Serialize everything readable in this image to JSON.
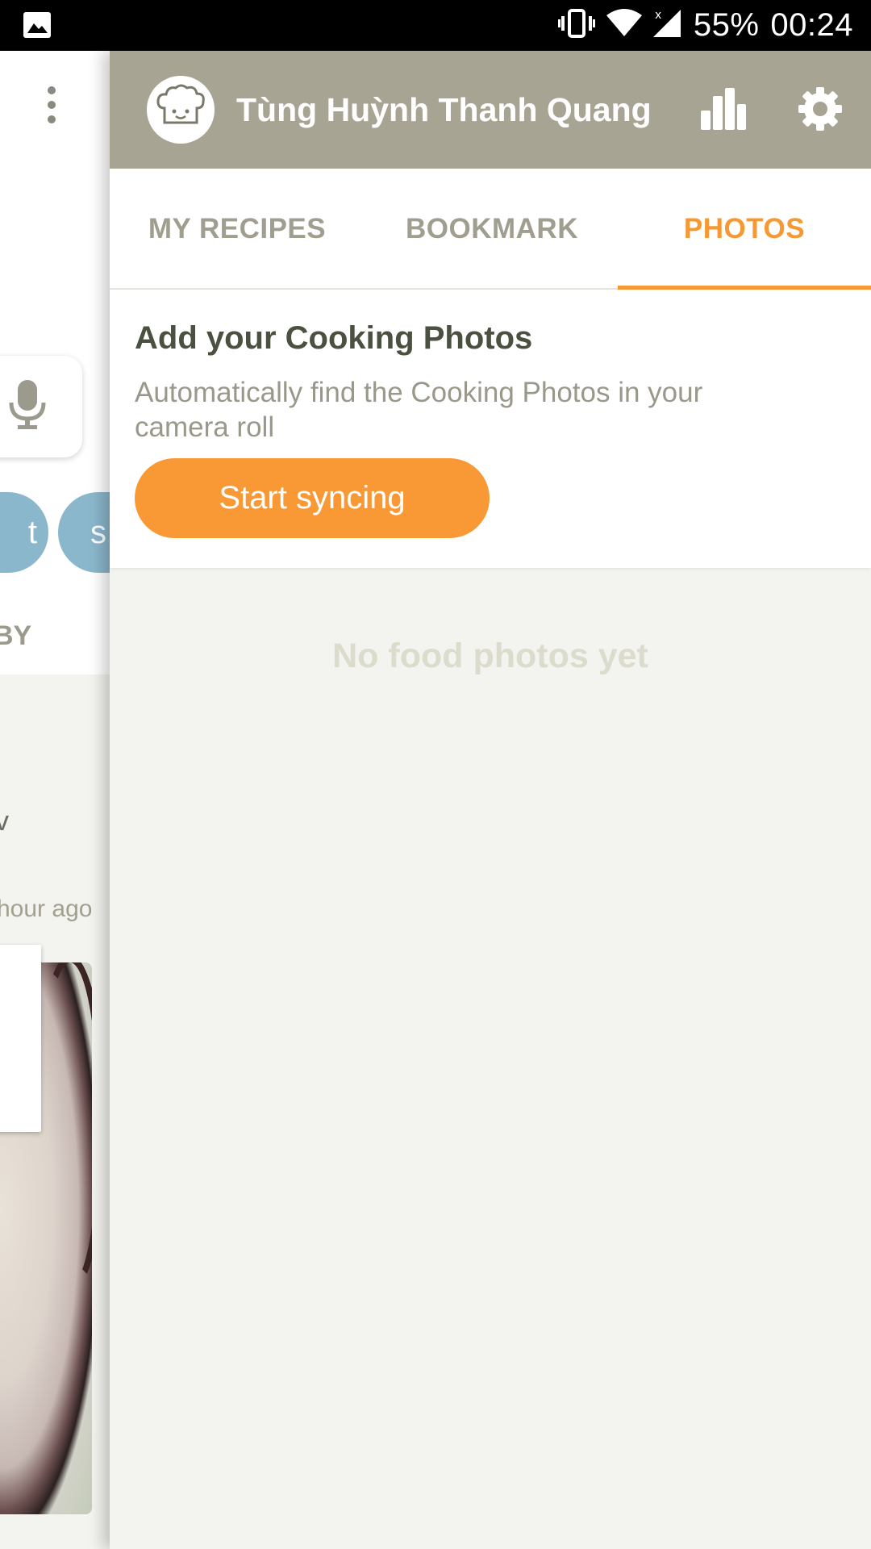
{
  "status_bar": {
    "battery": "55%",
    "time": "00:24"
  },
  "background": {
    "chip_1": "t",
    "chip_2": "s",
    "tab_partial": "BY",
    "text_partial": "v",
    "time_partial": "hour ago"
  },
  "profile": {
    "user_name": "Tùng Huỳnh Thanh Quang"
  },
  "tabs": [
    {
      "label": "MY RECIPES"
    },
    {
      "label": "BOOKMARK"
    },
    {
      "label": "PHOTOS"
    }
  ],
  "sync_card": {
    "title": "Add your Cooking Photos",
    "description": "Automatically find the Cooking Photos in your camera roll",
    "button_label": "Start syncing"
  },
  "empty_state": "No food photos yet",
  "colors": {
    "header": "#a8a493",
    "accent": "#f79832",
    "chip": "#8bb7cc"
  },
  "icons": [
    "image-icon",
    "vibrate-icon",
    "wifi-icon",
    "signal-icon",
    "more-icon",
    "microphone-icon",
    "chef-avatar-icon",
    "stats-icon",
    "settings-gear-icon"
  ]
}
